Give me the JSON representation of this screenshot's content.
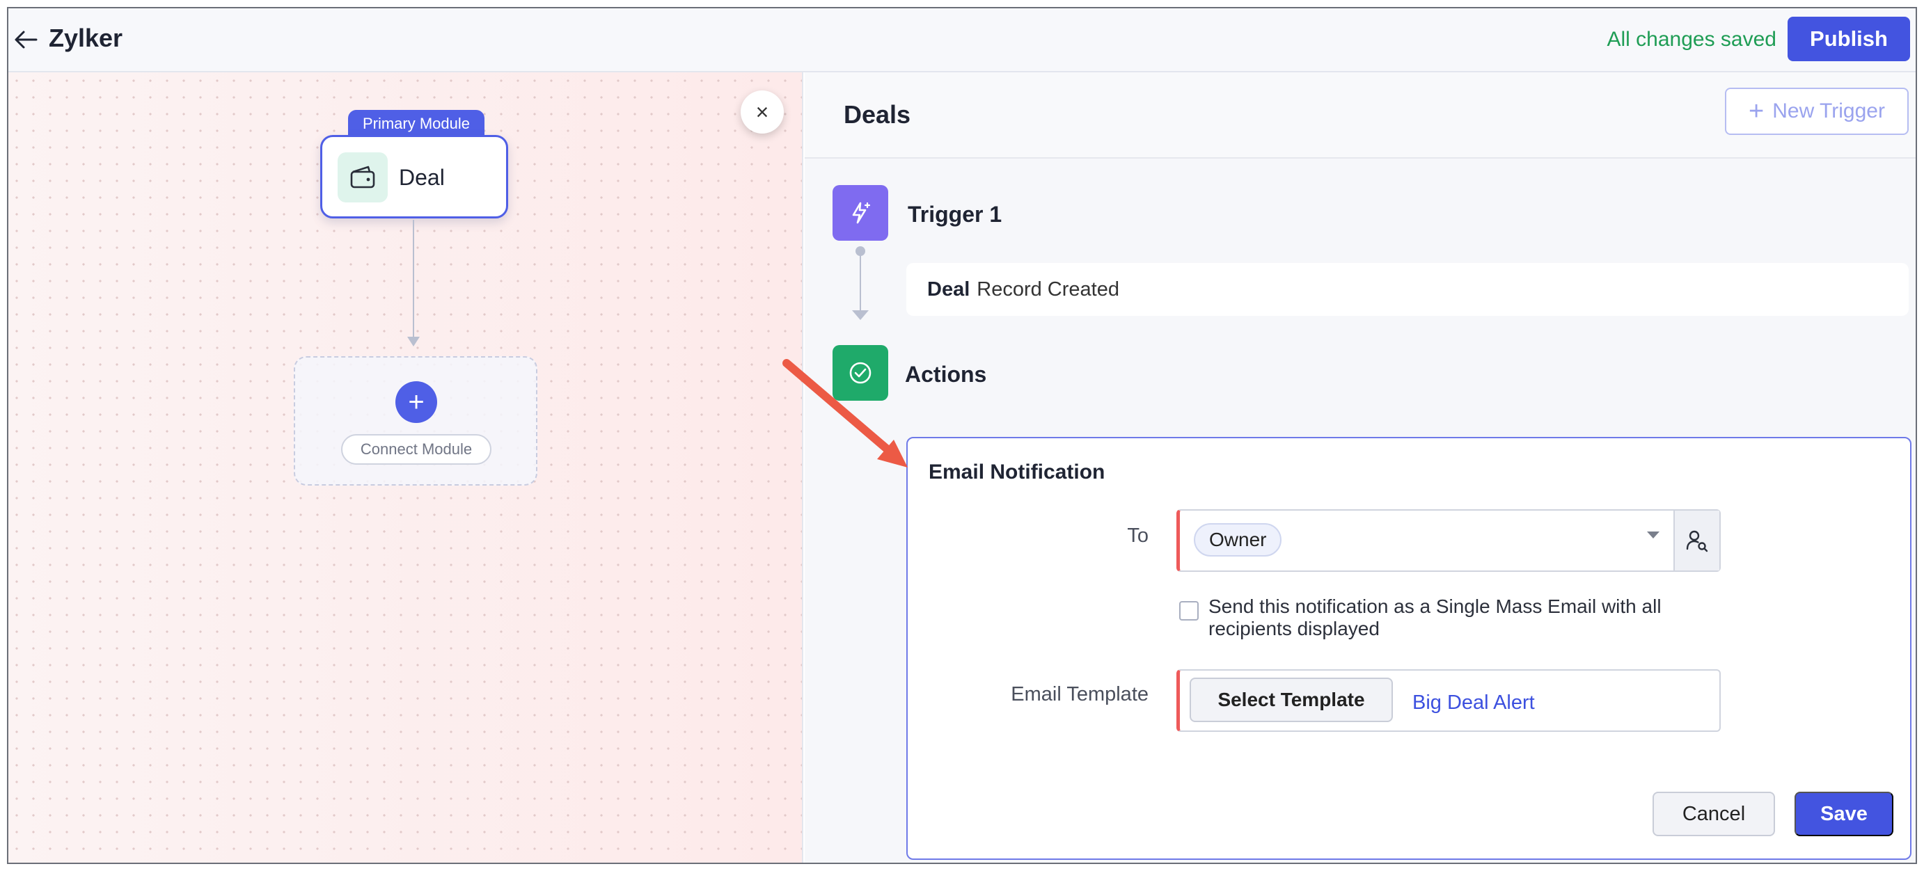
{
  "topbar": {
    "title": "Zylker",
    "status": "All changes saved",
    "publish_label": "Publish"
  },
  "canvas": {
    "primary_tag": "Primary Module",
    "node_label": "Deal",
    "connect_label": "Connect Module",
    "plus": "+",
    "close": "×"
  },
  "panel": {
    "title": "Deals",
    "new_trigger_label": "New Trigger",
    "trigger": {
      "label": "Trigger 1",
      "module": "Deal",
      "event": "Record Created"
    },
    "actions_label": "Actions",
    "email": {
      "title": "Email Notification",
      "to_label": "To",
      "recipient": "Owner",
      "mass_email_text": "Send this notification as a Single Mass Email with all recipients displayed",
      "mass_email_checked": false,
      "template_label": "Email Template",
      "select_template_label": "Select Template",
      "template_value": "Big Deal Alert",
      "cancel_label": "Cancel",
      "save_label": "Save"
    }
  },
  "colors": {
    "accent": "#4354e0",
    "saved_green": "#1f9d55",
    "trigger_purple": "#7f6bf0",
    "actions_green": "#1faa6a",
    "required_red": "#ee5a5a",
    "annotation_red": "#ec5a45"
  },
  "icons": {
    "back": "arrow-left-icon",
    "deal": "wallet-icon",
    "trigger": "lightning-icon",
    "actions": "check-circle-icon",
    "user_search": "user-search-icon",
    "new_trigger": "plus-icon"
  }
}
